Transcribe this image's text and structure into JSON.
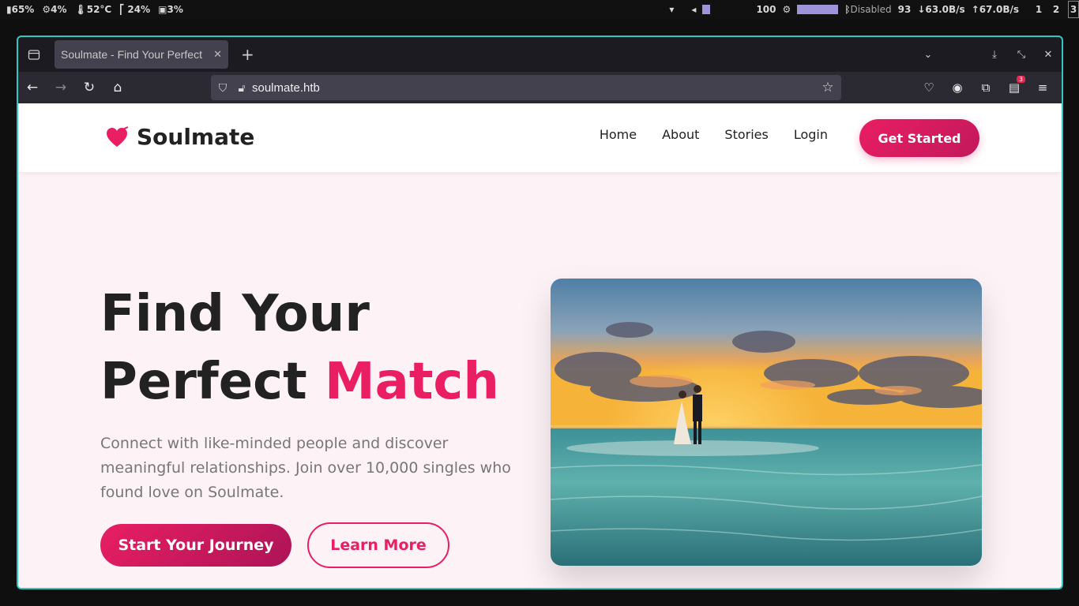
{
  "system_bar": {
    "battery": "65%",
    "cpu": "4%",
    "temp": "52°C",
    "memory": "24%",
    "disk": "3%",
    "volume": "100",
    "bluetooth": "Disabled",
    "wifi_strength": "93",
    "download": "↓63.0B/s",
    "upload": "↑67.0B/s",
    "workspaces": [
      "1",
      "2",
      "3"
    ]
  },
  "browser": {
    "tab_title": "Soulmate - Find Your Perfect",
    "url": "soulmate.htb",
    "extension_badge": "3"
  },
  "site": {
    "brand": "Soulmate",
    "nav": [
      "Home",
      "About",
      "Stories",
      "Login"
    ],
    "cta": "Get Started",
    "hero": {
      "title_line1": "Find Your",
      "title_line2": "Perfect ",
      "title_accent": "Match",
      "subtitle": "Connect with like-minded people and discover meaningful relationships. Join over 10,000 singles who found love on Soulmate.",
      "primary_button": "Start Your Journey",
      "secondary_button": "Learn More"
    }
  },
  "colors": {
    "accent": "#e91e63",
    "window_border": "#2fc7c0",
    "hero_bg": "#fdf2f6"
  }
}
